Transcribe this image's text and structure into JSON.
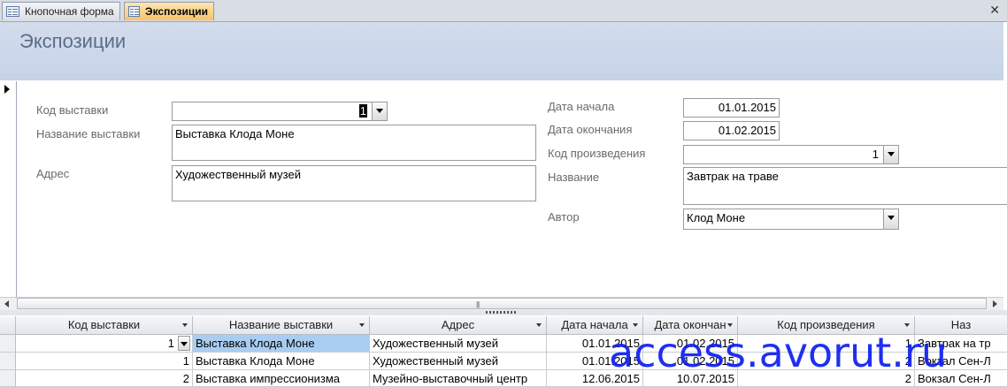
{
  "tabs": [
    {
      "label": "Кнопочная форма",
      "icon": "form-icon",
      "active": false
    },
    {
      "label": "Экспозиции",
      "icon": "form-icon",
      "active": true
    }
  ],
  "close_icon": "close-icon",
  "form": {
    "title": "Экспозиции",
    "fields": {
      "exhibition_code": {
        "label": "Код выставки",
        "value": "1"
      },
      "exhibition_name": {
        "label": "Название выставки",
        "value": "Выставка Клода Моне"
      },
      "address": {
        "label": "Адрес",
        "value": "Художественный музей"
      },
      "start_date": {
        "label": "Дата начала",
        "value": "01.01.2015"
      },
      "end_date": {
        "label": "Дата окончания",
        "value": "01.02.2015"
      },
      "artwork_code": {
        "label": "Код произведения",
        "value": "1"
      },
      "artwork_name": {
        "label": "Название",
        "value": "Завтрак на траве"
      },
      "author": {
        "label": "Автор",
        "value": "Клод Моне"
      }
    }
  },
  "scrollbar": {
    "grip": "|||"
  },
  "datasheet": {
    "columns": [
      "Код выставки",
      "Название выставки",
      "Адрес",
      "Дата начала",
      "Дата окончан",
      "Код произведения",
      "Наз"
    ],
    "rows": [
      [
        "1",
        "Выставка Клода Моне",
        "Художественный музей",
        "01.01.2015",
        "01.02.2015",
        "1",
        "Завтрак на тр"
      ],
      [
        "1",
        "Выставка Клода Моне",
        "Художественный музей",
        "01.01.2015",
        "01.02.2015",
        "2",
        "Вокзал Сен-Л"
      ],
      [
        "2",
        "Выставка импрессионизма",
        "Музейно-выставочный центр",
        "12.06.2015",
        "10.07.2015",
        "2",
        "Вокзал Сен-Л"
      ]
    ]
  },
  "watermark": "access.avorut.ru",
  "colors": {
    "header_bg": "#c6d3e8",
    "active_tab": "#f7c26a",
    "selected_cell": "#a9cdf1",
    "watermark": "#0d1ef0"
  }
}
